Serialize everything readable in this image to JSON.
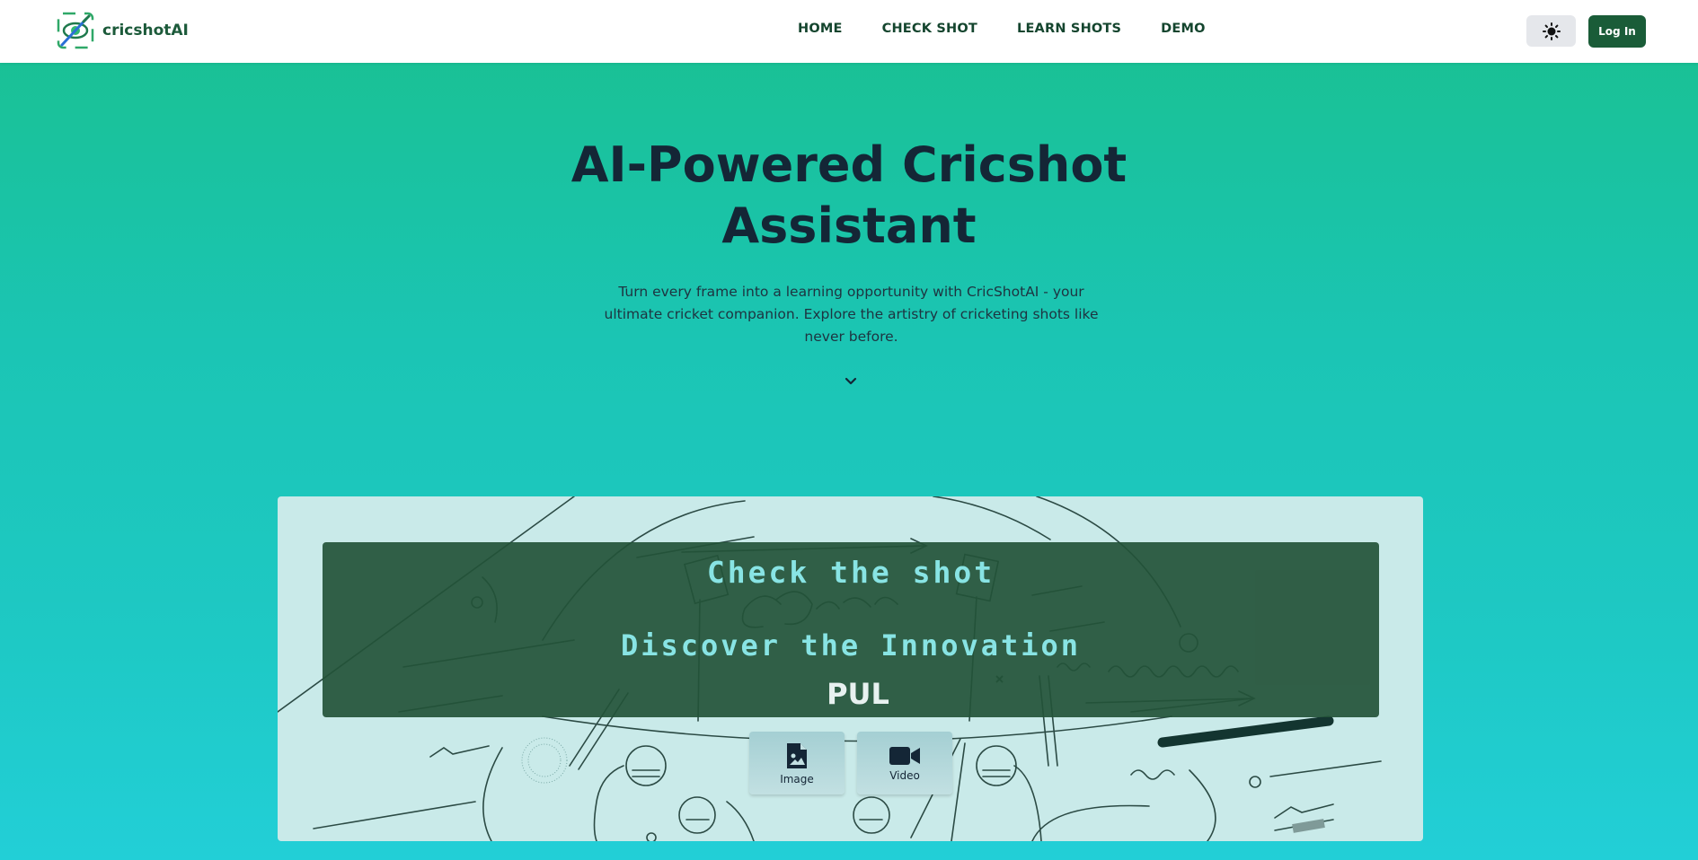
{
  "brand": {
    "name": "cricshotAI",
    "logo_icon": "cricket-bat-eye-logo-icon"
  },
  "nav": {
    "items": [
      "HOME",
      "CHECK SHOT",
      "LEARN SHOTS",
      "DEMO"
    ]
  },
  "header_actions": {
    "theme_icon": "sun-icon",
    "login_label": "Log In"
  },
  "hero": {
    "title": "AI-Powered Cricshot Assistant",
    "subtitle": "Turn every frame into a learning opportunity with CricShotAI - your ultimate cricket companion. Explore the artistry of cricketing shots like never before."
  },
  "card": {
    "banner_line1": "Check the shot",
    "banner_line2": "Discover the Innovation",
    "banner_line3": "PUL",
    "image_label": "Image",
    "video_label": "Video"
  },
  "colors": {
    "brand_green": "#1a5c38",
    "banner_bg": "#235238",
    "banner_text": "#88e4e4",
    "gradient_top": "#19c08f",
    "gradient_bottom": "#22cfd7"
  }
}
